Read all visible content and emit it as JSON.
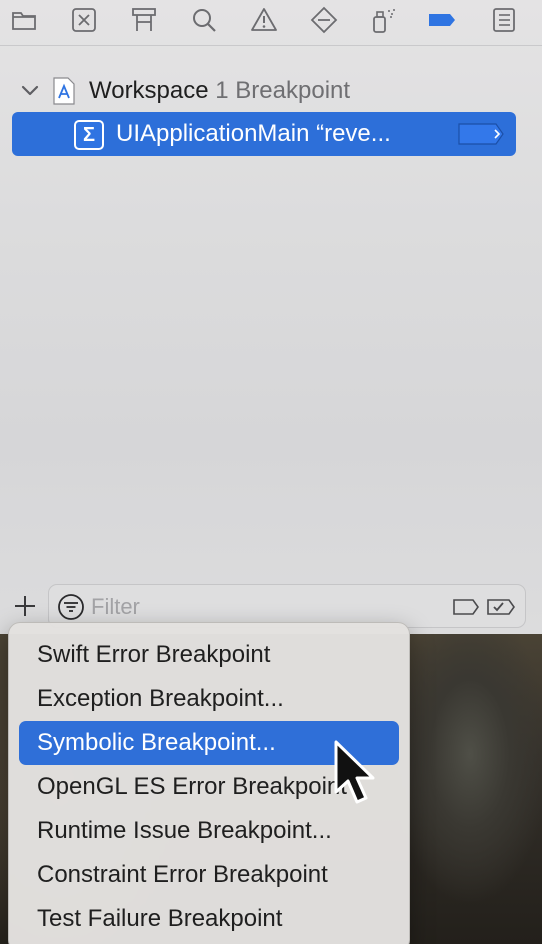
{
  "toolbar": {
    "icons": [
      "folder-icon",
      "source-control-icon",
      "hierarchy-icon",
      "search-icon",
      "warning-icon",
      "test-diamond-icon",
      "debug-spray-icon",
      "breakpoint-tag-icon",
      "report-list-icon"
    ],
    "active_icon": "breakpoint-tag-icon",
    "active_color": "#2f74e2"
  },
  "tree": {
    "workspace_name": "Workspace",
    "workspace_count": "1 Breakpoint",
    "breakpoint_name": "UIApplicationMain “reve...",
    "breakpoint_symbol": "Σ",
    "selected_color": "#2d6fd9"
  },
  "filter": {
    "placeholder": "Filter"
  },
  "menu": {
    "items": [
      "Swift Error Breakpoint",
      "Exception Breakpoint...",
      "Symbolic Breakpoint...",
      "OpenGL ES Error Breakpoint",
      "Runtime Issue Breakpoint...",
      "Constraint Error Breakpoint",
      "Test Failure Breakpoint"
    ],
    "selected_item": "Symbolic Breakpoint...",
    "highlight_color": "#2f6fd8"
  }
}
